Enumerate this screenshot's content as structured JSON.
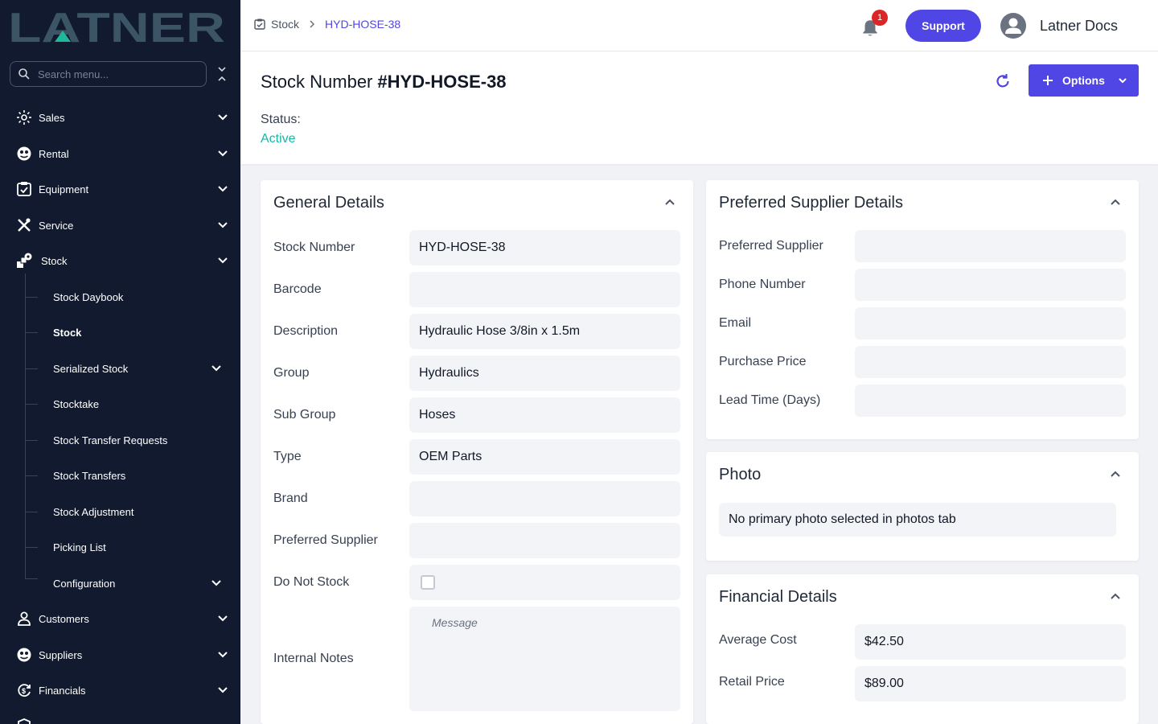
{
  "app": {
    "logo_text": "LATNER"
  },
  "sidebar": {
    "search_placeholder": "Search menu...",
    "items": [
      {
        "label": "Sales",
        "icon": "sales-icon"
      },
      {
        "label": "Rental",
        "icon": "rental-icon"
      },
      {
        "label": "Equipment",
        "icon": "equipment-icon"
      },
      {
        "label": "Service",
        "icon": "service-icon"
      },
      {
        "label": "Stock",
        "icon": "stock-icon"
      },
      {
        "label": "Customers",
        "icon": "customers-icon"
      },
      {
        "label": "Suppliers",
        "icon": "suppliers-icon"
      },
      {
        "label": "Financials",
        "icon": "financials-icon"
      }
    ],
    "stock_sub": [
      {
        "label": "Stock Daybook"
      },
      {
        "label": "Stock",
        "active": true
      },
      {
        "label": "Serialized Stock"
      },
      {
        "label": "Stocktake"
      },
      {
        "label": "Stock Transfer Requests"
      },
      {
        "label": "Stock Transfers"
      },
      {
        "label": "Stock Adjustment"
      },
      {
        "label": "Picking List"
      },
      {
        "label": "Configuration"
      }
    ]
  },
  "header": {
    "breadcrumb": [
      "Stock",
      "HYD-HOSE-38"
    ],
    "notification_count": "1",
    "support_label": "Support",
    "user_name": "Latner Docs"
  },
  "page": {
    "title_prefix": "Stock Number",
    "title_number": "#HYD-HOSE-38",
    "options_label": "Options",
    "status_label": "Status:",
    "status_value": "Active",
    "status_color": "#14b8a6"
  },
  "general": {
    "title": "General Details",
    "fields": [
      {
        "label": "Stock Number",
        "value": "HYD-HOSE-38"
      },
      {
        "label": "Barcode",
        "value": ""
      },
      {
        "label": "Description",
        "value": "Hydraulic Hose 3/8in x 1.5m"
      },
      {
        "label": "Group",
        "value": "Hydraulics"
      },
      {
        "label": "Sub Group",
        "value": "Hoses"
      },
      {
        "label": "Type",
        "value": "OEM Parts"
      },
      {
        "label": "Brand",
        "value": ""
      },
      {
        "label": "Preferred Supplier",
        "value": ""
      },
      {
        "label": "Do Not Stock",
        "value": ""
      },
      {
        "label": "Internal Notes",
        "value": ""
      }
    ],
    "notes_placeholder": "Message"
  },
  "supplier": {
    "title": "Preferred Supplier Details",
    "fields": [
      {
        "label": "Preferred Supplier",
        "value": ""
      },
      {
        "label": "Phone Number",
        "value": ""
      },
      {
        "label": "Email",
        "value": ""
      },
      {
        "label": "Purchase Price",
        "value": ""
      },
      {
        "label": "Lead Time (Days)",
        "value": ""
      }
    ]
  },
  "photo": {
    "title": "Photo",
    "empty_text": "No primary photo selected in photos tab"
  },
  "financial": {
    "title": "Financial Details",
    "fields": [
      {
        "label": "Average Cost",
        "value": "$42.50"
      },
      {
        "label": "Retail Price",
        "value": "$89.00"
      }
    ]
  },
  "colors": {
    "accent": "#4f46e5",
    "sidebar": "#111a2e",
    "logo": "#3c5566",
    "logo_triangle": "#1fb99a"
  }
}
